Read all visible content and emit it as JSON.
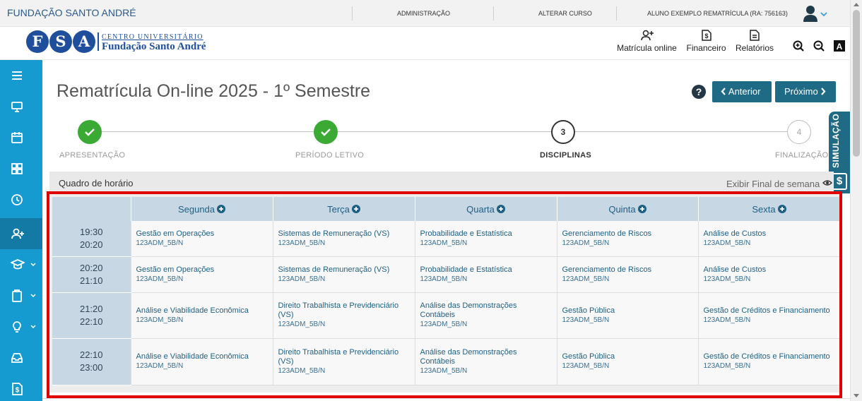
{
  "topbar": {
    "org": "FUNDAÇÃO SANTO ANDRÉ",
    "admin": "ADMINISTRAÇÃO",
    "alterar": "ALTERAR CURSO",
    "user": "ALUNO EXEMPLO REMATRÍCULA (RA: 756163)"
  },
  "logo": {
    "letters": [
      "F",
      "S",
      "A"
    ],
    "line1": "CENTRO UNIVERSITÁRIO",
    "line2": "Fundação Santo André"
  },
  "header": {
    "nav": [
      "Matrícula online",
      "Financeiro",
      "Relatórios"
    ],
    "zoom_in_icon": "zoom-in-icon",
    "zoom_out_icon": "zoom-out-icon",
    "contrast_icon": "contrast-icon"
  },
  "sidebar": {
    "items": [
      {
        "icon": "menu-icon"
      },
      {
        "icon": "monitor-icon"
      },
      {
        "icon": "calendar-icon"
      },
      {
        "icon": "grid-icon"
      },
      {
        "icon": "clock-icon"
      },
      {
        "icon": "add-user-icon",
        "active": true
      },
      {
        "icon": "graduation-cap-icon",
        "expandable": true
      },
      {
        "icon": "clipboard-icon",
        "expandable": true
      },
      {
        "icon": "lightbulb-icon",
        "expandable": true
      },
      {
        "icon": "inbox-icon"
      },
      {
        "icon": "finance-icon"
      }
    ]
  },
  "page": {
    "title": "Rematrícula On-line 2025 - 1º Semestre",
    "help": "?",
    "prev": "Anterior",
    "next": "Próximo"
  },
  "steps": [
    {
      "label": "APRESENTAÇÃO",
      "state": "done"
    },
    {
      "label": "PERÍODO LETIVO",
      "state": "done"
    },
    {
      "label": "DISCIPLINAS",
      "state": "current",
      "number": "3"
    },
    {
      "label": "FINALIZAÇÃO",
      "state": "todo",
      "number": "4"
    }
  ],
  "simulacao": {
    "label": "SIMULAÇÃO",
    "symbol": "$"
  },
  "schedule": {
    "title": "Quadro de horário",
    "weekend_toggle": "Exibir Final de semana",
    "days": [
      "Segunda",
      "Terça",
      "Quarta",
      "Quinta",
      "Sexta"
    ],
    "rows": [
      {
        "start": "19:30",
        "end": "20:20",
        "cells": [
          {
            "subject": "Gestão em Operações",
            "code": "123ADM_5B/N"
          },
          {
            "subject": "Sistemas de Remuneração (VS)",
            "code": "123ADM_5B/N"
          },
          {
            "subject": "Probabilidade e Estatística",
            "code": "123ADM_5B/N"
          },
          {
            "subject": "Gerenciamento de Riscos",
            "code": "123ADM_5B/N"
          },
          {
            "subject": "Análise de Custos",
            "code": "123ADM_5B/N"
          }
        ]
      },
      {
        "start": "20:20",
        "end": "21:10",
        "cells": [
          {
            "subject": "Gestão em Operações",
            "code": "123ADM_5B/N"
          },
          {
            "subject": "Sistemas de Remuneração (VS)",
            "code": "123ADM_5B/N"
          },
          {
            "subject": "Probabilidade e Estatística",
            "code": "123ADM_5B/N"
          },
          {
            "subject": "Gerenciamento de Riscos",
            "code": "123ADM_5B/N"
          },
          {
            "subject": "Análise de Custos",
            "code": "123ADM_5B/N"
          }
        ]
      },
      {
        "start": "21:20",
        "end": "22:10",
        "cells": [
          {
            "subject": "Análise e Viabilidade Econômica",
            "code": "123ADM_5B/N"
          },
          {
            "subject": "Direito Trabalhista e Previdenciário (VS)",
            "code": "123ADM_5B/N"
          },
          {
            "subject": "Análise das Demonstrações Contábeis",
            "code": "123ADM_5B/N"
          },
          {
            "subject": "Gestão Pública",
            "code": "123ADM_5B/N"
          },
          {
            "subject": "Gestão de Créditos e Financiamento",
            "code": "123ADM_5B/N"
          }
        ]
      },
      {
        "start": "22:10",
        "end": "23:00",
        "cells": [
          {
            "subject": "Análise e Viabilidade Econômica",
            "code": "123ADM_5B/N"
          },
          {
            "subject": "Direito Trabalhista e Previdenciário (VS)",
            "code": "123ADM_5B/N"
          },
          {
            "subject": "Análise das Demonstrações Contábeis",
            "code": "123ADM_5B/N"
          },
          {
            "subject": "Gestão Pública",
            "code": "123ADM_5B/N"
          },
          {
            "subject": "Gestão de Créditos e Financiamento",
            "code": "123ADM_5B/N"
          }
        ]
      }
    ]
  },
  "colors": {
    "sidebar": "#159bd0",
    "primary": "#1f6b86",
    "done_step": "#3aaa35",
    "highlight": "#e10000"
  }
}
